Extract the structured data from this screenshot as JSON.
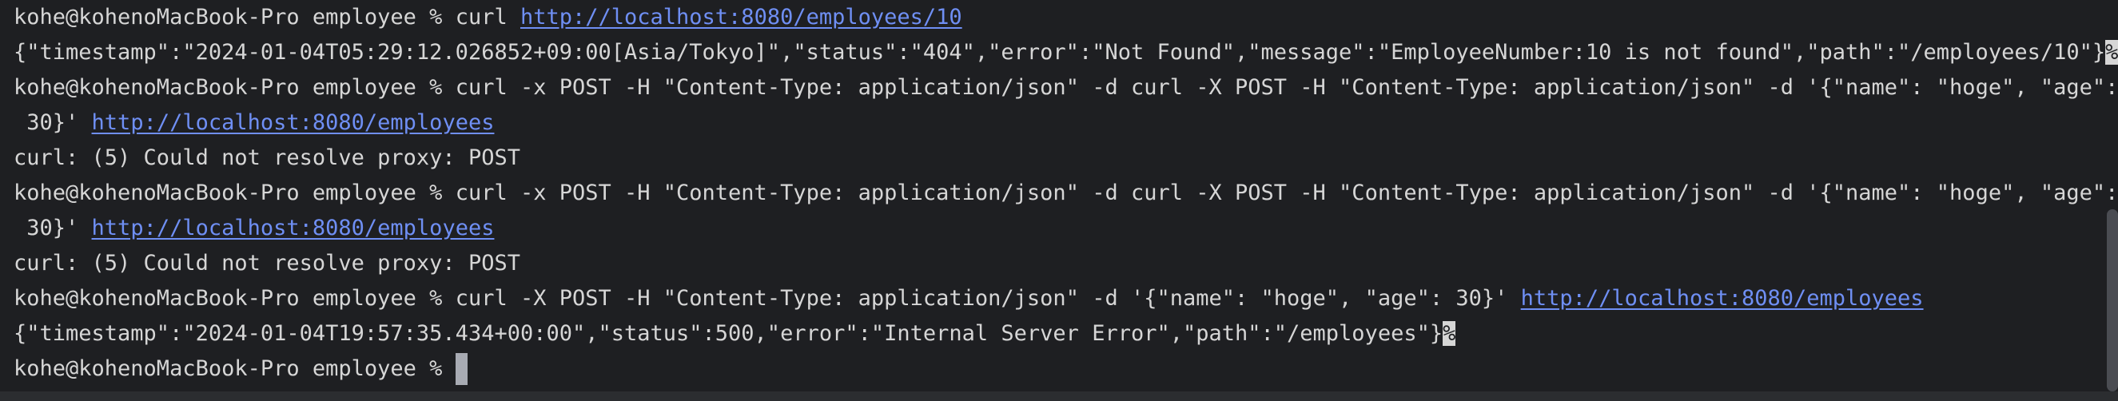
{
  "terminal": {
    "lines": [
      {
        "prompt": "kohe@kohenoMacBook-Pro employee % ",
        "cmd": "curl ",
        "url": "http://localhost:8080/employees/10"
      },
      {
        "text": "{\"timestamp\":\"2024-01-04T05:29:12.026852+09:00[Asia/Tokyo]\",\"status\":\"404\",\"error\":\"Not Found\",\"message\":\"EmployeeNumber:10 is not found\",\"path\":\"/employees/10\"}",
        "eol_mark": "%"
      },
      {
        "prompt": "kohe@kohenoMacBook-Pro employee % ",
        "cmd": "curl -x POST -H \"Content-Type: application/json\" -d curl -X POST -H \"Content-Type: application/json\" -d '{\"name\": \"hoge\", \"age\":"
      },
      {
        "text": " 30}' ",
        "url": "http://localhost:8080/employees"
      },
      {
        "text": "curl: (5) Could not resolve proxy: POST"
      },
      {
        "prompt": "kohe@kohenoMacBook-Pro employee % ",
        "cmd": "curl -x POST -H \"Content-Type: application/json\" -d curl -X POST -H \"Content-Type: application/json\" -d '{\"name\": \"hoge\", \"age\":"
      },
      {
        "text": " 30}' ",
        "url": "http://localhost:8080/employees"
      },
      {
        "text": "curl: (5) Could not resolve proxy: POST"
      },
      {
        "prompt": "kohe@kohenoMacBook-Pro employee % ",
        "cmd": "curl -X POST -H \"Content-Type: application/json\" -d '{\"name\": \"hoge\", \"age\": 30}' ",
        "url": "http://localhost:8080/employees"
      },
      {
        "text": "{\"timestamp\":\"2024-01-04T19:57:35.434+00:00\",\"status\":500,\"error\":\"Internal Server Error\",\"path\":\"/employees\"}",
        "eol_mark": "%"
      },
      {
        "prompt": "kohe@kohenoMacBook-Pro employee % "
      }
    ]
  },
  "colors": {
    "background": "#1e1f22",
    "text": "#d6d6d6",
    "link": "#6f8ff4"
  }
}
